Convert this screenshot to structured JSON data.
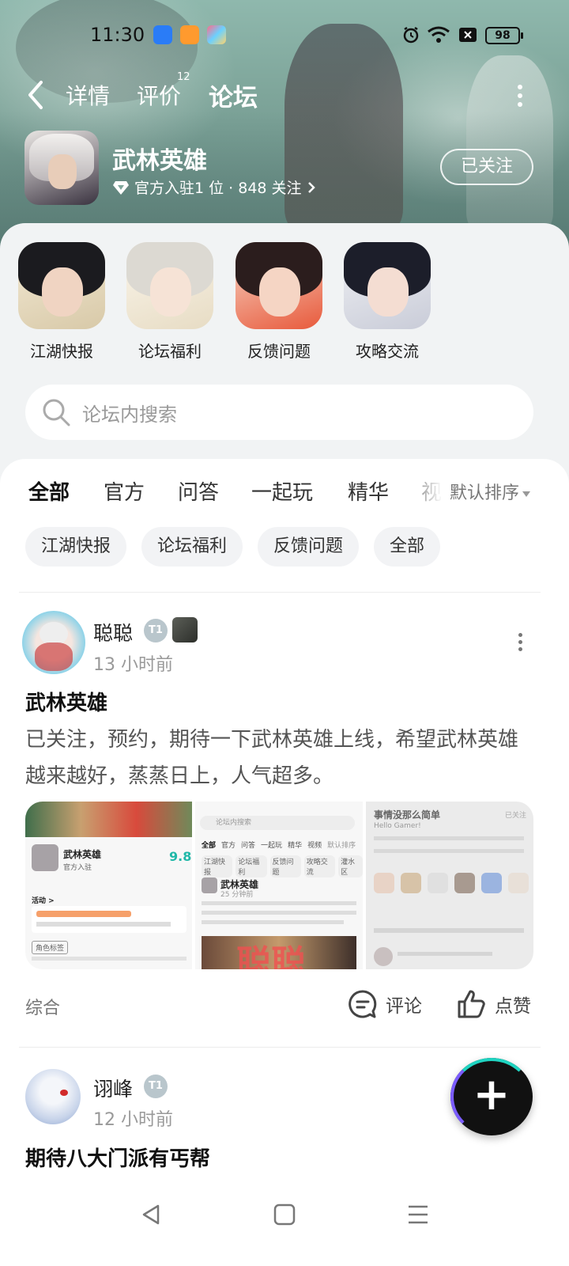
{
  "status_bar": {
    "time": "11:30",
    "battery": "98"
  },
  "nav": {
    "tabs": [
      {
        "label": "详情"
      },
      {
        "label": "评价",
        "badge": "12"
      },
      {
        "label": "论坛"
      }
    ],
    "active_tab": "论坛"
  },
  "game": {
    "name": "武林英雄",
    "meta": "官方入驻1 位 · 848 关注",
    "follow_label": "已关注"
  },
  "boards": [
    {
      "label": "江湖快报"
    },
    {
      "label": "论坛福利"
    },
    {
      "label": "反馈问题"
    },
    {
      "label": "攻略交流"
    }
  ],
  "search": {
    "placeholder": "论坛内搜索"
  },
  "category_tabs": [
    {
      "label": "全部"
    },
    {
      "label": "官方"
    },
    {
      "label": "问答"
    },
    {
      "label": "一起玩"
    },
    {
      "label": "精华"
    },
    {
      "label": "视"
    }
  ],
  "sort": {
    "label": "默认排序"
  },
  "chips": [
    {
      "label": "江湖快报"
    },
    {
      "label": "论坛福利"
    },
    {
      "label": "反馈问题"
    },
    {
      "label": "全部"
    }
  ],
  "posts": [
    {
      "author": "聪聪",
      "time": "13 小时前",
      "title": "武林英雄",
      "body": "已关注，预约，期待一下武林英雄上线，希望武林英雄越来越好，蒸蒸日上，人气超多。",
      "category": "综合",
      "comment_label": "评论",
      "like_label": "点赞",
      "images": [
        {
          "title": "武林英雄",
          "rating": "9.8",
          "note": "官方入驻",
          "section": "活动 >",
          "tag": "角色标签"
        },
        {
          "title": "武林英雄",
          "watermark": "聪聪",
          "search": "论坛内搜索",
          "tabs": [
            "全部",
            "官方",
            "问答",
            "一起玩",
            "精华",
            "视频",
            "默认排序"
          ],
          "chips": [
            "江湖快报",
            "论坛福利",
            "反馈问题",
            "攻略交流",
            "灌水区"
          ],
          "post_time": "25 分钟前"
        },
        {
          "title": "事情没那么简单",
          "follow": "已关注",
          "sub": "Hello Gamer!"
        }
      ]
    },
    {
      "author": "诩峰",
      "time": "12 小时前",
      "title": "期待八大门派有丐帮"
    }
  ],
  "fab": {
    "label": "+"
  },
  "colors": {
    "accent": "#1fd4c1",
    "header_bg": "#7fa69b",
    "page_bg": "#f2f4f5"
  }
}
